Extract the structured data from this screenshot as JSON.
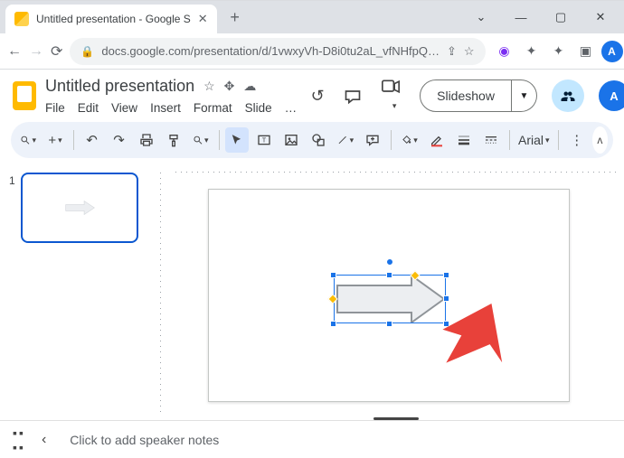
{
  "window": {
    "tab_title": "Untitled presentation - Google S",
    "url": "docs.google.com/presentation/d/1vwxyVh-D8i0tu2aL_vfNHfpQ…",
    "avatar_letter": "A"
  },
  "doc": {
    "title": "Untitled presentation",
    "menus": [
      "File",
      "Edit",
      "View",
      "Insert",
      "Format",
      "Slide",
      "…"
    ]
  },
  "header": {
    "slideshow_label": "Slideshow",
    "avatar_letter": "A"
  },
  "toolbar": {
    "font": "Arial"
  },
  "filmstrip": {
    "slides": [
      {
        "number": "1"
      }
    ]
  },
  "notes": {
    "placeholder": "Click to add speaker notes"
  }
}
